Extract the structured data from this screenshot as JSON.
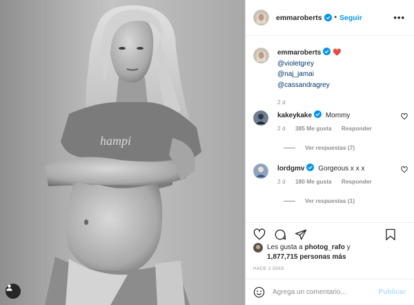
{
  "post": {
    "author": "emmaroberts",
    "follow_label": "Seguir",
    "more_label": "•••",
    "verified_color": "#0095f6"
  },
  "caption": {
    "author": "emmaroberts",
    "emoji": "❤️",
    "mentions": [
      "@violetgrey",
      "@naj_jamai",
      "@cassandragrey"
    ],
    "time": "2 d"
  },
  "comments": [
    {
      "author": "kakeykake",
      "text": "Mommy",
      "time": "2 d",
      "likes": "385 Me gusta",
      "reply_label": "Responder",
      "view_replies": "Ver respuestas (7)"
    },
    {
      "author": "lordgmv",
      "text": "Gorgeous x x x",
      "time": "2 d",
      "likes": "180 Me gusta",
      "reply_label": "Responder",
      "view_replies": "Ver respuestas (1)"
    }
  ],
  "likes": {
    "prefix": "Les gusta a",
    "user": "photog_rafo",
    "connector": "y",
    "count": "1,877,715 personas más"
  },
  "timestamp": "HACE 2 DÍAS",
  "comment_box": {
    "placeholder": "Agrega un comentario...",
    "publish_label": "Publicar"
  },
  "icons": {
    "like": "heart-icon",
    "comment": "comment-icon",
    "share": "share-icon",
    "save": "bookmark-icon",
    "emoji": "emoji-icon",
    "tag": "user-tag-icon"
  }
}
